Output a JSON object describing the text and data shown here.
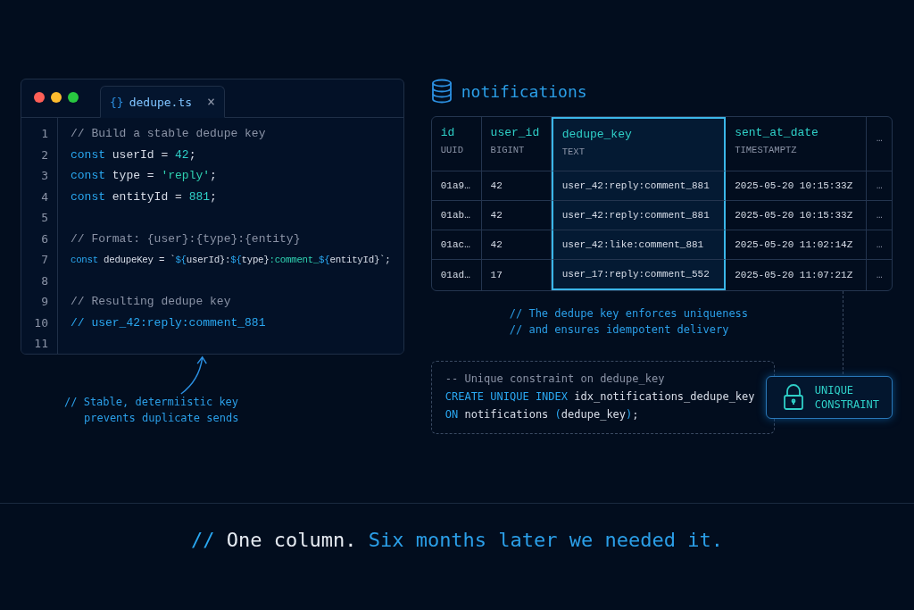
{
  "editor": {
    "window_controls": [
      {
        "color": "#ff5f57"
      },
      {
        "color": "#febc2e"
      },
      {
        "color": "#28c840"
      }
    ],
    "tab": {
      "icon": "{}",
      "label": "dedupe.ts",
      "close": "×",
      "selected": true
    },
    "lines": [
      {
        "number": "1",
        "tokens": [
          {
            "kind": "comment",
            "text": "// Build a stable dedupe key"
          }
        ]
      },
      {
        "number": "2",
        "tokens": [
          {
            "kind": "keyword",
            "text": "const"
          },
          {
            "kind": "ident",
            "text": " userId = "
          },
          {
            "kind": "number",
            "text": "42"
          },
          {
            "kind": "ident",
            "text": ";"
          }
        ]
      },
      {
        "number": "3",
        "tokens": [
          {
            "kind": "keyword",
            "text": "const"
          },
          {
            "kind": "ident",
            "text": " type = "
          },
          {
            "kind": "string",
            "text": "'reply'"
          },
          {
            "kind": "ident",
            "text": ";"
          }
        ]
      },
      {
        "number": "4",
        "tokens": [
          {
            "kind": "keyword",
            "text": "const"
          },
          {
            "kind": "ident",
            "text": " entityId = "
          },
          {
            "kind": "number",
            "text": "881"
          },
          {
            "kind": "ident",
            "text": ";"
          }
        ]
      },
      {
        "number": "5"
      },
      {
        "number": "6",
        "tokens": [
          {
            "kind": "comment",
            "text": "// Format: {user}:{type}:{entity}"
          }
        ]
      },
      {
        "number": "7",
        "tokens": [
          {
            "kind": "keyword",
            "text": "const"
          },
          {
            "kind": "ident",
            "text": " dedupeKey = `"
          },
          {
            "kind": "keyword",
            "text": "${"
          },
          {
            "kind": "ident",
            "text": "userId}:"
          },
          {
            "kind": "keyword",
            "text": "${"
          },
          {
            "kind": "ident",
            "text": "type}"
          },
          {
            "kind": "string",
            "text": ":comment_"
          },
          {
            "kind": "keyword",
            "text": "${"
          },
          {
            "kind": "ident",
            "text": "entityId}`;"
          }
        ]
      },
      {
        "number": "8"
      },
      {
        "number": "9",
        "tokens": [
          {
            "kind": "comment",
            "text": "// Resulting dedupe key"
          }
        ]
      },
      {
        "number": "10",
        "tokens": [
          {
            "kind": "accent",
            "text": "// user_42:reply:comment_881"
          }
        ]
      },
      {
        "number": "11"
      }
    ]
  },
  "editor_note": [
    "// Stable, determiistic key",
    "prevents duplicate sends"
  ],
  "table": {
    "title": "notifications",
    "columns": [
      {
        "name": "id",
        "type": "UUID",
        "highlighted": false
      },
      {
        "name": "user_id",
        "type": "BIGINT",
        "highlighted": false
      },
      {
        "name": "dedupe_key",
        "type": "TEXT",
        "highlighted": true
      },
      {
        "name": "sent_at_date",
        "type": "TIMESTAMPTZ",
        "highlighted": false
      },
      {
        "name": "…",
        "highlighted": false
      }
    ],
    "rows": [
      [
        "01a9…",
        "42",
        "user_42:reply:comment_881",
        "2025-05-20 10:15:33Z",
        "…"
      ],
      [
        "01ab…",
        "42",
        "user_42:reply:comment_881",
        "2025-05-20 10:15:33Z",
        "…"
      ],
      [
        "01ac…",
        "42",
        "user_42:like:comment_881",
        "2025-05-20 11:02:14Z",
        "…"
      ],
      [
        "01ad…",
        "17",
        "user_17:reply:comment_552",
        "2025-05-20 11:07:21Z",
        "…"
      ]
    ]
  },
  "table_note": [
    "// The dedupe key enforces uniqueness",
    "// and ensures idempotent delivery"
  ],
  "sql": [
    [
      {
        "kind": "comment",
        "text": "-- Unique constraint on dedupe_key"
      }
    ],
    [
      {
        "kind": "keyword",
        "text": "CREATE UNIQUE INDEX"
      },
      {
        "kind": "ident",
        "text": " idx_notifications_dedupe_key"
      }
    ],
    [
      {
        "kind": "keyword",
        "text": "ON"
      },
      {
        "kind": "ident",
        "text": " notifications "
      },
      {
        "kind": "keyword",
        "text": "("
      },
      {
        "kind": "ident",
        "text": "dedupe_key"
      },
      {
        "kind": "keyword",
        "text": ")"
      },
      {
        "kind": "ident",
        "text": ";"
      }
    ]
  ],
  "badge": {
    "lines": [
      "UNIQUE",
      "CONSTRAINT"
    ]
  },
  "caption": [
    {
      "kind": "slashes",
      "text": "//"
    },
    {
      "kind": "plain",
      "text": " One column. "
    },
    {
      "kind": "accent",
      "text": "Six months later we needed it."
    }
  ]
}
